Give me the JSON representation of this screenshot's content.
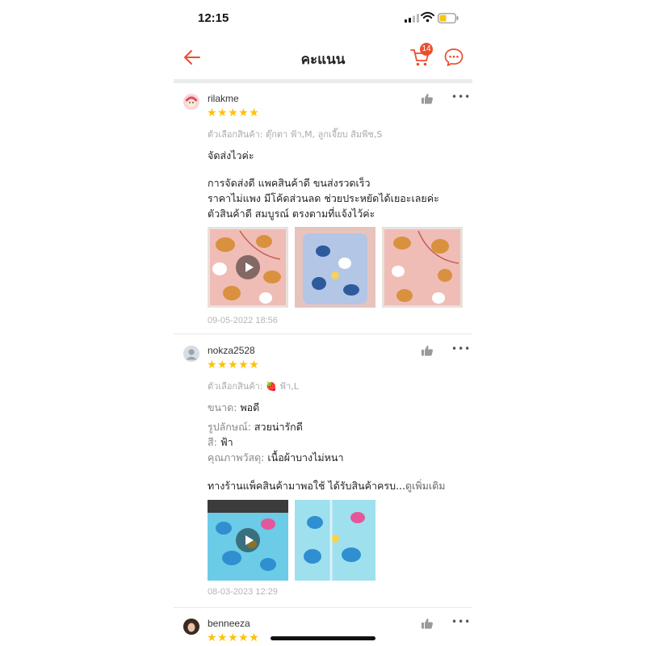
{
  "status": {
    "time": "12:15"
  },
  "header": {
    "title": "คะแนน",
    "cart_count": "14"
  },
  "colors": {
    "accent": "#ee4d2d",
    "star": "#ffc107"
  },
  "icons": [
    "back-arrow-icon",
    "cart-icon",
    "chat-icon",
    "thumbs-up-icon",
    "more-icon",
    "play-icon"
  ],
  "reviews": [
    {
      "username": "rilakme",
      "stars": "★★★★★",
      "variant": "ตัวเลือกสินค้า: ตุ๊กตา ฟ้า,M, ลูกเจี๊ยบ ส้มพีช,S",
      "line1": "จัดส่งไวค่ะ",
      "line2": "การจัดส่งดี  แพคสินค้าดี ขนส่งรวดเร็ว",
      "line3": "ราคาไม่แพง มีโค้ดส่วนลด ช่วยประหยัดได้เยอะเลยค่ะ",
      "line4": "ตัวสินค้าดี สมบูรณ์  ตรงตามที่แจ้งไว้ค่ะ",
      "date": "09-05-2022 18:56"
    },
    {
      "username": "nokza2528",
      "stars": "★★★★★",
      "variant": "ตัวเลือกสินค้า: 🍓 ฟ้า,L",
      "size_label": "ขนาด:",
      "size_value": "พอดี",
      "look_label": "รูปลักษณ์:",
      "look_value": "สวยน่ารักดี",
      "color_label": "สี:",
      "color_value": "ฟ้า",
      "quality_label": "คุณภาพวัสดุ:",
      "quality_value": "เนื้อผ้าบางไม่หนา",
      "body": "ทางร้านแพ็คสินค้ามาพอใช้ ได้รับสินค้าครบ...",
      "see_more": "ดูเพิ่มเติม",
      "date": "08-03-2023 12:29"
    },
    {
      "username": "benneeza",
      "stars": "★★★★★"
    }
  ]
}
